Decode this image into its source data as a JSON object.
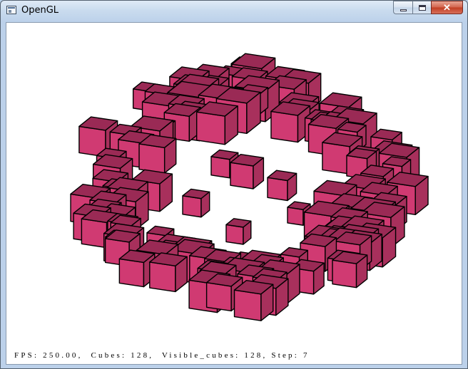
{
  "window": {
    "title": "OpenGL",
    "app_icon": "window-app-icon",
    "buttons": {
      "minimize_icon": "minimize-icon",
      "maximize_icon": "maximize-icon",
      "close_icon": "close-icon",
      "close_glyph": "✕"
    }
  },
  "viewport": {
    "background_color": "#ffffff",
    "cube_color": "#d03a72",
    "cube_edge_color": "#000000",
    "hud_text": "FPS: 250.00,  Cubes: 128,  Visible_cubes: 128, Step: 7"
  }
}
